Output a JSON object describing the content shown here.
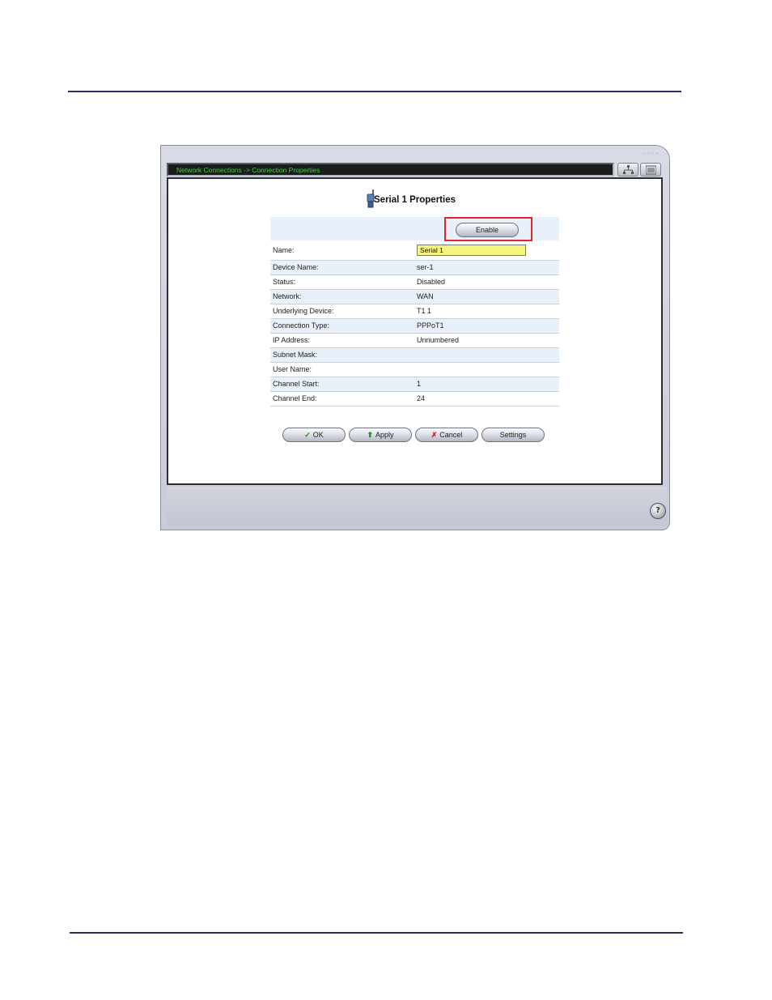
{
  "breadcrumb": "Network Connections -> Connection Properties",
  "page_title": "Serial 1 Properties",
  "enable_button": "Enable",
  "properties": [
    {
      "label": "Name:",
      "value": "Serial 1"
    },
    {
      "label": "Device Name:",
      "value": "ser-1"
    },
    {
      "label": "Status:",
      "value": "Disabled"
    },
    {
      "label": "Network:",
      "value": "WAN"
    },
    {
      "label": "Underlying Device:",
      "value": "T1 1"
    },
    {
      "label": "Connection Type:",
      "value": "PPPoT1"
    },
    {
      "label": "IP Address:",
      "value": "Unnumbered"
    },
    {
      "label": "Subnet Mask:",
      "value": ""
    },
    {
      "label": "User Name:",
      "value": ""
    },
    {
      "label": "Channel Start:",
      "value": "1"
    },
    {
      "label": "Channel End:",
      "value": "24"
    }
  ],
  "actions": {
    "ok": "OK",
    "apply": "Apply",
    "cancel": "Cancel",
    "settings": "Settings"
  },
  "help_glyph": "?",
  "icons": {
    "serial": "serial-connection-icon",
    "network_map": "network-map-icon",
    "list_view": "list-view-icon",
    "help": "help-icon"
  },
  "colors": {
    "breadcrumb_text": "#3fd43f",
    "name_field_bg": "#f6f47f",
    "highlight_box": "#e1262c",
    "row_shade": "#e8f0fa"
  }
}
